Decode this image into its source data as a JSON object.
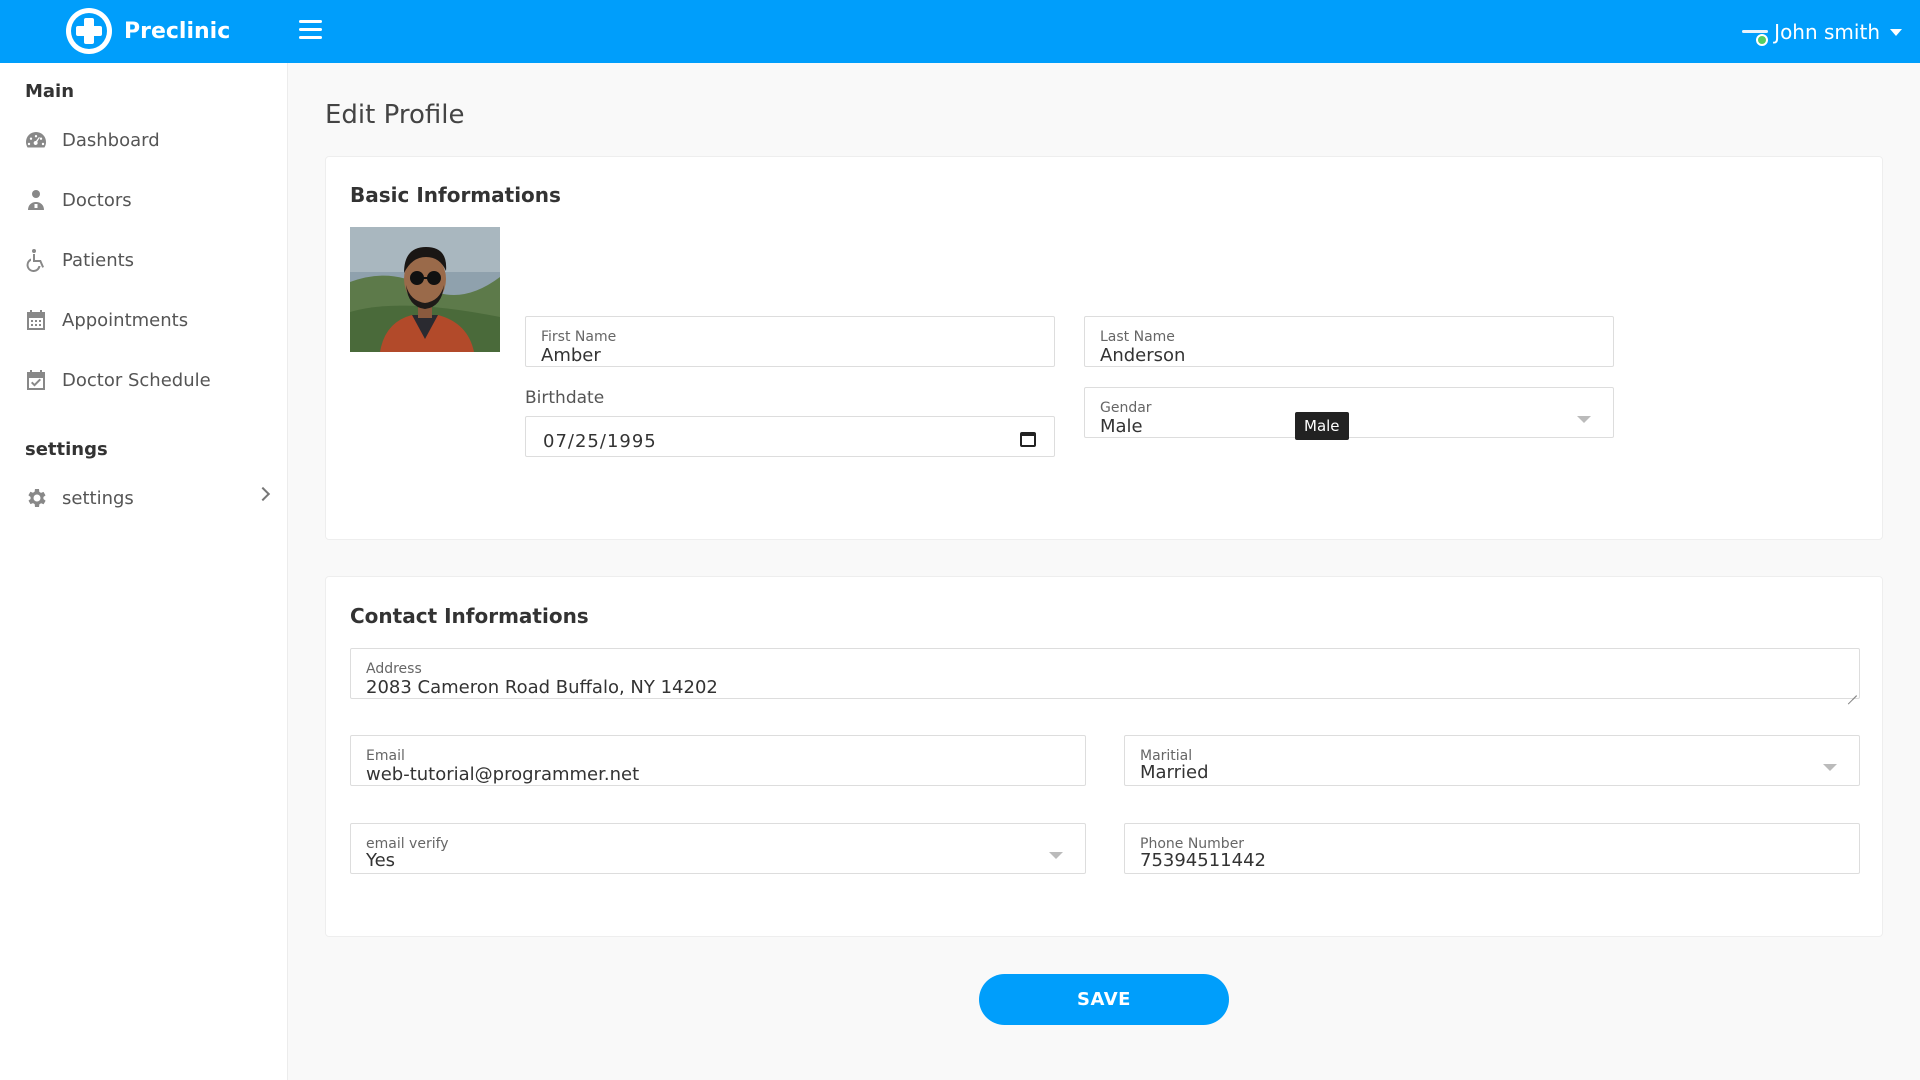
{
  "app": {
    "name": "Preclinic"
  },
  "user": {
    "name": "John smith"
  },
  "sidebar": {
    "section_main": "Main",
    "items": [
      {
        "label": "Dashboard",
        "icon": "dashboard-icon"
      },
      {
        "label": "Doctors",
        "icon": "doctor-icon"
      },
      {
        "label": "Patients",
        "icon": "wheelchair-icon"
      },
      {
        "label": "Appointments",
        "icon": "calendar-icon"
      },
      {
        "label": "Doctor Schedule",
        "icon": "calendar-check-icon"
      }
    ],
    "section_settings": "settings",
    "settings_item": {
      "label": "settings",
      "icon": "gear-icon"
    }
  },
  "page": {
    "title": "Edit Profile"
  },
  "basic": {
    "title": "Basic Informations",
    "first_name": {
      "label": "First Name",
      "value": "Amber"
    },
    "last_name": {
      "label": "Last Name",
      "value": "Anderson"
    },
    "birthdate": {
      "label": "Birthdate",
      "value": "07/25/1995"
    },
    "gender": {
      "label": "Gendar",
      "value": "Male",
      "tooltip": "Male"
    }
  },
  "contact": {
    "title": "Contact Informations",
    "address": {
      "label": "Address",
      "value": "2083 Cameron Road Buffalo, NY 14202"
    },
    "email": {
      "label": "Email",
      "value": "web-tutorial@programmer.net"
    },
    "marital": {
      "label": "Maritial",
      "value": "Married"
    },
    "email_verify": {
      "label": "email verify",
      "value": "Yes"
    },
    "phone": {
      "label": "Phone Number",
      "value": "75394511442"
    }
  },
  "actions": {
    "save_label": "SAVE"
  },
  "colors": {
    "primary": "#009efb",
    "online": "#55ce63"
  }
}
